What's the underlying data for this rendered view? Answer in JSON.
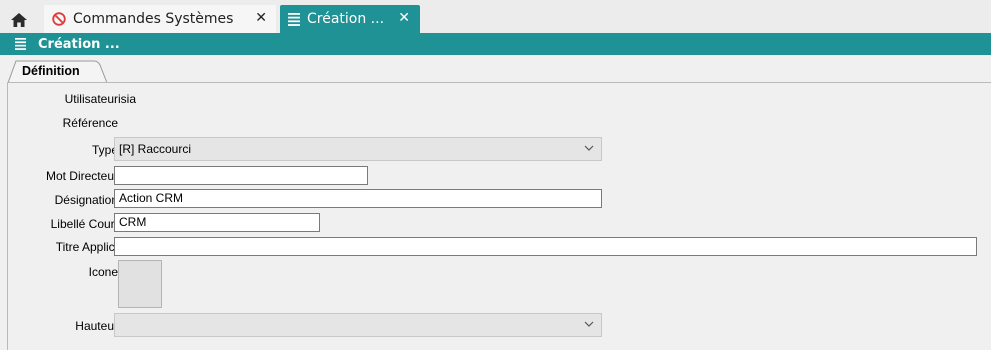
{
  "tabs": [
    {
      "label": "Commandes Systèmes",
      "icon": "no-entry-icon"
    },
    {
      "label": "Création ...",
      "icon": "document-icon",
      "active": true
    }
  ],
  "window_title": "Création ...",
  "subtab_label": "Définition",
  "form": {
    "utilisateur_label": "Utilisateur",
    "utilisateur_value": "isia",
    "reference_label": "Référence",
    "type_label": "Type",
    "type_value": "[R] Raccourci",
    "mot_directeur_label": "Mot Directeur",
    "mot_directeur_value": "",
    "designation_label": "Désignation",
    "designation_value": "Action CRM",
    "libelle_court_label": "Libellé Court",
    "libelle_court_value": "CRM",
    "titre_applic_label": "Titre Applic.",
    "titre_applic_value": "",
    "icone_label": "Icone",
    "hauteur_label": "Hauteur",
    "hauteur_value": ""
  },
  "colors": {
    "accent": "#1f9296",
    "background": "#f0f0f0",
    "no_entry": "#e03a3a"
  }
}
